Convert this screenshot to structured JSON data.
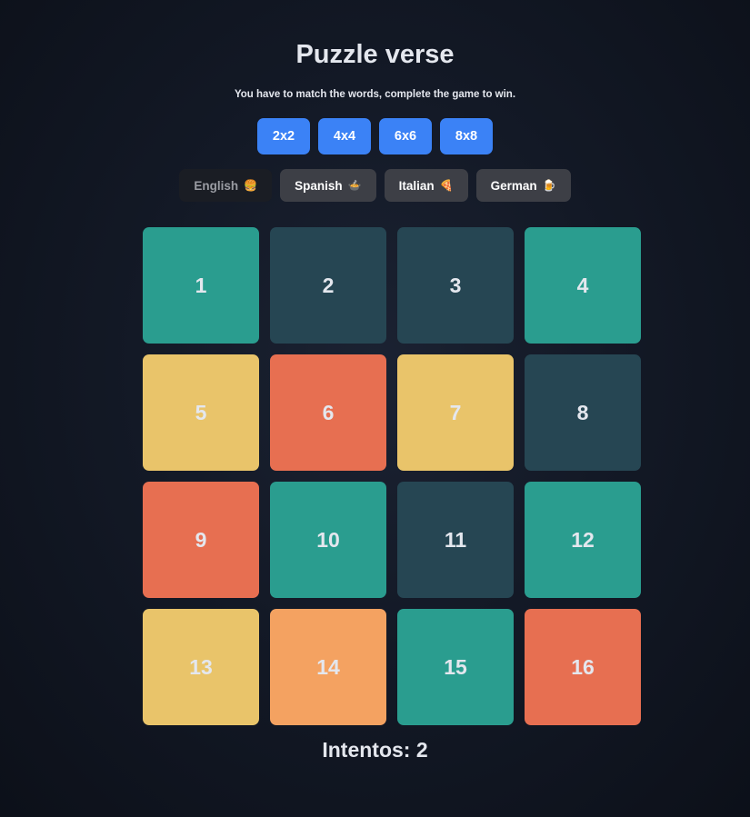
{
  "header": {
    "title": "Puzzle verse",
    "subtitle": "You have to match the words, complete the game to win."
  },
  "size_options": [
    {
      "label": "2x2"
    },
    {
      "label": "4x4"
    },
    {
      "label": "6x6"
    },
    {
      "label": "8x8"
    }
  ],
  "languages": [
    {
      "label": "English",
      "emoji": "🍔",
      "active": true
    },
    {
      "label": "Spanish",
      "emoji": "🍲",
      "active": false
    },
    {
      "label": "Italian",
      "emoji": "🍕",
      "active": false
    },
    {
      "label": "German",
      "emoji": "🍺",
      "active": false
    }
  ],
  "board": {
    "grid": "4x4",
    "tiles": [
      {
        "label": "1",
        "color": "teal"
      },
      {
        "label": "2",
        "color": "dark"
      },
      {
        "label": "3",
        "color": "dark"
      },
      {
        "label": "4",
        "color": "teal"
      },
      {
        "label": "5",
        "color": "yellow"
      },
      {
        "label": "6",
        "color": "red"
      },
      {
        "label": "7",
        "color": "yellow"
      },
      {
        "label": "8",
        "color": "dark"
      },
      {
        "label": "9",
        "color": "red"
      },
      {
        "label": "10",
        "color": "teal"
      },
      {
        "label": "11",
        "color": "dark"
      },
      {
        "label": "12",
        "color": "teal"
      },
      {
        "label": "13",
        "color": "yellow"
      },
      {
        "label": "14",
        "color": "orange"
      },
      {
        "label": "15",
        "color": "teal"
      },
      {
        "label": "16",
        "color": "red"
      }
    ]
  },
  "tile_colors": {
    "teal": "#2a9d8f",
    "dark": "#264653",
    "yellow": "#e9c46a",
    "red": "#e76f51",
    "orange": "#f4a261"
  },
  "accent_color": "#3b82f6",
  "status": {
    "attempts_text": "Intentos: 2"
  }
}
